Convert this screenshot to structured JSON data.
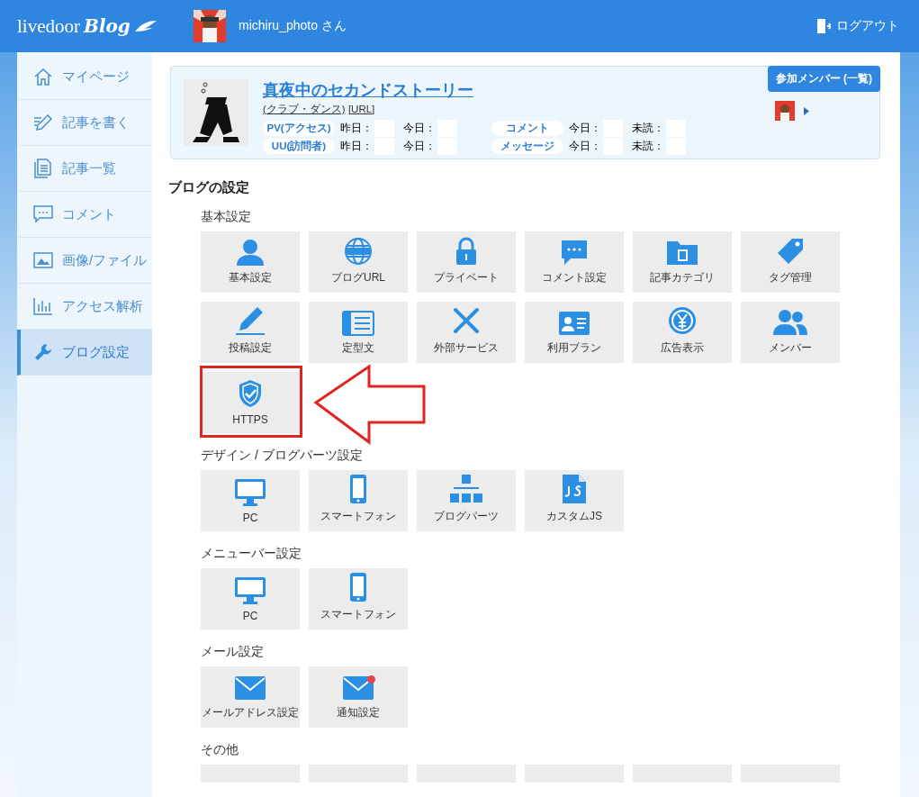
{
  "header": {
    "logo_text": "livedoor",
    "logo_script": "Blog",
    "user": "michiru_photo さん",
    "logout": "ログアウト"
  },
  "sidebar": {
    "items": [
      {
        "label": "マイページ",
        "selected": false
      },
      {
        "label": "記事を書く",
        "selected": false
      },
      {
        "label": "記事一覧",
        "selected": false
      },
      {
        "label": "コメント",
        "selected": false
      },
      {
        "label": "画像/ファイル",
        "selected": false
      },
      {
        "label": "アクセス解析",
        "selected": false
      },
      {
        "label": "ブログ設定",
        "selected": true
      }
    ]
  },
  "blog": {
    "title": "真夜中のセカンドストーリー",
    "category": "(クラブ・ダンス)",
    "url_link": "[URL]",
    "members_button": "参加メンバー (一覧)",
    "stats_left": [
      {
        "label": "PV(アクセス)",
        "cells": [
          "昨日：",
          "今日："
        ]
      },
      {
        "label": "UU(訪問者)",
        "cells": [
          "昨日：",
          "今日："
        ]
      }
    ],
    "stats_right": [
      {
        "label": "コメント",
        "cells": [
          "今日：",
          "未読："
        ]
      },
      {
        "label": "メッセージ",
        "cells": [
          "今日：",
          "未読："
        ]
      }
    ]
  },
  "settings": {
    "title": "ブログの設定",
    "sections": [
      {
        "heading": "基本設定",
        "tiles": [
          {
            "label": "基本設定",
            "highlighted": false,
            "notification": false
          },
          {
            "label": "ブログURL",
            "highlighted": false,
            "notification": false
          },
          {
            "label": "プライベート",
            "highlighted": false,
            "notification": false
          },
          {
            "label": "コメント設定",
            "highlighted": false,
            "notification": false
          },
          {
            "label": "記事カテゴリ",
            "highlighted": false,
            "notification": false
          },
          {
            "label": "タグ管理",
            "highlighted": false,
            "notification": false
          },
          {
            "label": "投稿設定",
            "highlighted": false,
            "notification": false
          },
          {
            "label": "定型文",
            "highlighted": false,
            "notification": false
          },
          {
            "label": "外部サービス",
            "highlighted": false,
            "notification": false
          },
          {
            "label": "利用プラン",
            "highlighted": false,
            "notification": false
          },
          {
            "label": "広告表示",
            "highlighted": false,
            "notification": false
          },
          {
            "label": "メンバー",
            "highlighted": false,
            "notification": false
          },
          {
            "label": "HTTPS",
            "highlighted": true,
            "notification": false
          }
        ]
      },
      {
        "heading": "デザイン / ブログパーツ設定",
        "tiles": [
          {
            "label": "PC",
            "highlighted": false,
            "notification": false
          },
          {
            "label": "スマートフォン",
            "highlighted": false,
            "notification": false
          },
          {
            "label": "ブログパーツ",
            "highlighted": false,
            "notification": false
          },
          {
            "label": "カスタムJS",
            "highlighted": false,
            "notification": false
          }
        ]
      },
      {
        "heading": "メニューバー設定",
        "tiles": [
          {
            "label": "PC",
            "highlighted": false,
            "notification": false
          },
          {
            "label": "スマートフォン",
            "highlighted": false,
            "notification": false
          }
        ]
      },
      {
        "heading": "メール設定",
        "tiles": [
          {
            "label": "メールアドレス設定",
            "highlighted": false,
            "notification": false
          },
          {
            "label": "通知設定",
            "highlighted": false,
            "notification": true
          }
        ]
      },
      {
        "heading": "その他",
        "tiles": [
          {
            "cut": true
          },
          {
            "cut": true
          },
          {
            "cut": true
          },
          {
            "cut": true
          },
          {
            "cut": true
          },
          {
            "cut": true
          }
        ]
      }
    ]
  }
}
